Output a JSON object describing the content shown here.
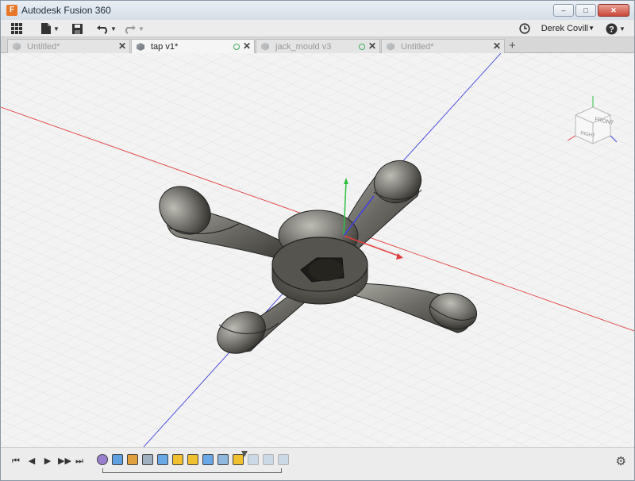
{
  "window": {
    "title": "Autodesk Fusion 360",
    "app_icon_letter": "F",
    "controls": {
      "minimize": "–",
      "maximize": "□",
      "close": "✕"
    }
  },
  "toolbar": {
    "grid_icon": "app-grid-icon",
    "file_icon": "file-icon",
    "save_icon": "save-icon",
    "undo_icon": "undo-icon",
    "redo_icon": "redo-icon",
    "history_icon": "clock-icon",
    "user_name": "Derek Covill",
    "help_icon": "help-icon"
  },
  "tabs": [
    {
      "label": "Untitled*",
      "active": false,
      "has_dot": false
    },
    {
      "label": "tap v1*",
      "active": true,
      "has_dot": true
    },
    {
      "label": "jack_mould v3",
      "active": false,
      "has_dot": true
    },
    {
      "label": "Untitled*",
      "active": false,
      "has_dot": false
    }
  ],
  "tab_add": "+",
  "viewcube": {
    "front_label": "FRONT",
    "side_label": "RIGHT"
  },
  "timeline": {
    "controls": [
      "⏮",
      "◀",
      "▶",
      "▶▶",
      "⏭"
    ],
    "settings_icon": "gear-icon"
  },
  "colors": {
    "accent": "#e8772a",
    "x_axis": "#e04040",
    "y_axis": "#4040e0",
    "z_axis": "#30c040",
    "model_dark": "#3a3934",
    "model_light": "#9b9a94"
  }
}
